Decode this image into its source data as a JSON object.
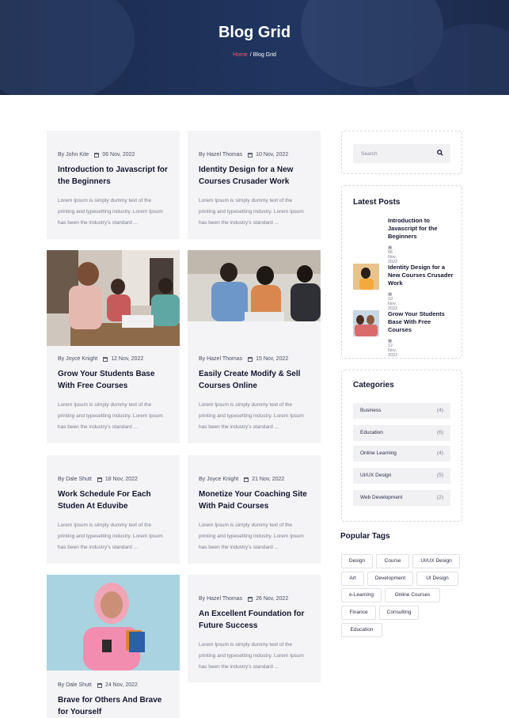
{
  "hero": {
    "title": "Blog Grid",
    "breadcrumb_home": "Home",
    "breadcrumb_sep": "/",
    "breadcrumb_current": "Blog Grid"
  },
  "posts": [
    {
      "author": "By John Kite",
      "date": "06 Nov, 2022",
      "title": "Introduction to Javascript for the Beginners",
      "excerpt": "Lorem Ipsum is simply dummy text of the printing and typesetting industry. Lorem Ipsum has been the industry's standard ..."
    },
    {
      "author": "By Hazel Thomas",
      "date": "10 Nov, 2022",
      "title": "Identity Design for a New Courses Crusader Work",
      "excerpt": "Lorem Ipsum is simply dummy text of the printing and typesetting industry. Lorem Ipsum has been the industry's standard ..."
    },
    {
      "author": "By Joyce Knight",
      "date": "12 Nov, 2022",
      "title": "Grow Your Students Base With Free Courses",
      "excerpt": "Lorem Ipsum is simply dummy text of the printing and typesetting industry. Lorem Ipsum has been the industry's standard ..."
    },
    {
      "author": "By Hazel Thomas",
      "date": "15 Nov, 2022",
      "title": "Easily Create Modify & Sell Courses Online",
      "excerpt": "Lorem Ipsum is simply dummy text of the printing and typesetting industry. Lorem Ipsum has been the industry's standard ..."
    },
    {
      "author": "By Dale Shutt",
      "date": "18 Nov, 2022",
      "title": "Work Schedule For Each Studen At Eduvibe",
      "excerpt": "Lorem Ipsum is simply dummy text of the printing and typesetting industry. Lorem Ipsum has been the industry's standard ..."
    },
    {
      "author": "By Joyce Knight",
      "date": "21 Nov, 2022",
      "title": "Monetize Your Coaching Site With Paid Courses",
      "excerpt": "Lorem Ipsum is simply dummy text of the printing and typesetting industry. Lorem Ipsum has been the industry's standard ..."
    },
    {
      "author": "By Hazel Thomas",
      "date": "26 Nov, 2022",
      "title": "An Excellent Foundation for Future Success",
      "excerpt": "Lorem Ipsum is simply dummy text of the printing and typesetting industry. Lorem Ipsum has been the industry's standard ..."
    },
    {
      "author": "By Dale Shutt",
      "date": "24 Nov, 2022",
      "title": "Brave for Others And Brave for Yourself",
      "excerpt": ""
    }
  ],
  "sidebar": {
    "search_placeholder": "Search",
    "latest_title": "Latest Posts",
    "latest": [
      {
        "title": "Introduction to Javascript for the Beginners",
        "date": "06 Nov, 2022"
      },
      {
        "title": "Identity Design for a New Courses Crusader Work",
        "date": "10 Nov, 2022"
      },
      {
        "title": "Grow Your Students Base With Free Courses",
        "date": "12 Nov, 2022"
      }
    ],
    "categories_title": "Categories",
    "categories": [
      {
        "name": "Business",
        "count": "(4)"
      },
      {
        "name": "Education",
        "count": "(6)"
      },
      {
        "name": "Online Learning",
        "count": "(4)"
      },
      {
        "name": "UI/UX Design",
        "count": "(5)"
      },
      {
        "name": "Web Development",
        "count": "(2)"
      }
    ],
    "tags_title": "Popular Tags",
    "tags": [
      "Design",
      "Course",
      "UI/UX Design",
      "Art",
      "Development",
      "UI Design",
      "e-Learning",
      "Online Courses",
      "Finance",
      "Consulting",
      "Education"
    ]
  },
  "colors": {
    "hero_bg": "#1e3158",
    "accent": "#ff5a6e",
    "card_bg": "#f4f4f6",
    "title": "#141630"
  }
}
